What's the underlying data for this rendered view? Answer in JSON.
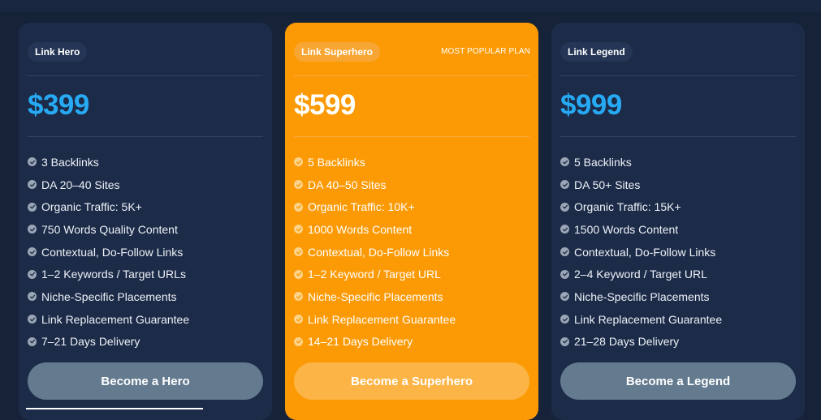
{
  "plans": [
    {
      "name": "Link Hero",
      "price": "$399",
      "features": [
        "3 Backlinks",
        "DA 20–40 Sites",
        "Organic Traffic: 5K+",
        "750 Words Quality Content",
        "Contextual, Do-Follow Links",
        "1–2 Keywords / Target URLs",
        "Niche-Specific Placements",
        "Link Replacement Guarantee",
        "7–21 Days Delivery"
      ],
      "cta": "Become a Hero"
    },
    {
      "name": "Link Superhero",
      "badge": "MOST POPULAR PLAN",
      "price": "$599",
      "features": [
        "5 Backlinks",
        "DA 40–50 Sites",
        "Organic Traffic: 10K+",
        "1000 Words Content",
        "Contextual, Do-Follow Links",
        "1–2 Keyword / Target URL",
        "Niche-Specific Placements",
        "Link Replacement Guarantee",
        "14–21 Days Delivery"
      ],
      "cta": "Become a Superhero"
    },
    {
      "name": "Link Legend",
      "price": "$999",
      "features": [
        "5 Backlinks",
        "DA 50+ Sites",
        "Organic Traffic: 15K+",
        "1500 Words Content",
        "Contextual, Do-Follow Links",
        "2–4 Keyword / Target URL",
        "Niche-Specific Placements",
        "Link Replacement Guarantee",
        "21–28 Days Delivery"
      ],
      "cta": "Become a Legend"
    }
  ],
  "colors": {
    "background": "#162238",
    "card": "#1c2b48",
    "featured_card": "#fb9a05",
    "price_accent": "#27aaf4",
    "button": "#637a8f",
    "featured_button": "#fcb446"
  },
  "icons": {
    "feature_check": "check-circle-icon"
  }
}
